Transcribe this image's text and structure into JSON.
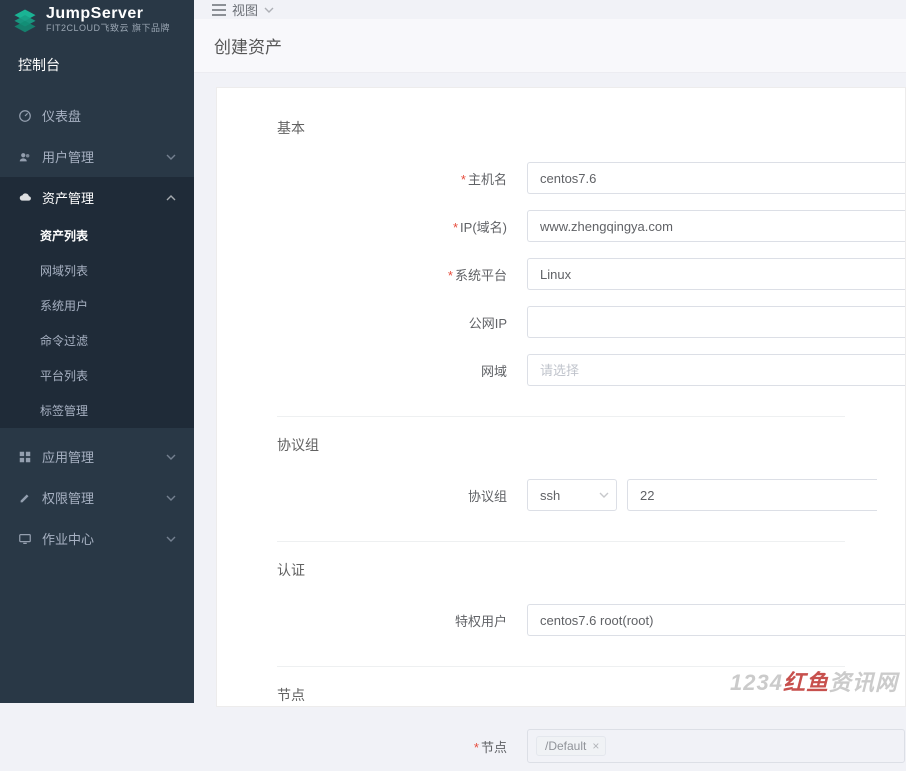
{
  "brand": {
    "title": "JumpServer",
    "subtitle": "FIT2CLOUD飞致云 旗下品牌"
  },
  "sidebar": {
    "console": "控制台",
    "items": [
      {
        "label": "仪表盘",
        "icon": "dashboard-icon"
      },
      {
        "label": "用户管理",
        "icon": "users-icon",
        "expandable": true
      },
      {
        "label": "资产管理",
        "icon": "cloud-icon",
        "expandable": true,
        "active": true,
        "children": [
          {
            "label": "资产列表",
            "active": true
          },
          {
            "label": "网域列表"
          },
          {
            "label": "系统用户"
          },
          {
            "label": "命令过滤"
          },
          {
            "label": "平台列表"
          },
          {
            "label": "标签管理"
          }
        ]
      },
      {
        "label": "应用管理",
        "icon": "grid-icon",
        "expandable": true
      },
      {
        "label": "权限管理",
        "icon": "edit-icon",
        "expandable": true
      },
      {
        "label": "作业中心",
        "icon": "display-icon",
        "expandable": true
      }
    ]
  },
  "topbar": {
    "view_label": "视图"
  },
  "page": {
    "title": "创建资产"
  },
  "sections": {
    "basic": "基本",
    "protocol": "协议组",
    "auth": "认证",
    "node": "节点"
  },
  "form": {
    "hostname": {
      "label": "主机名",
      "value": "centos7.6"
    },
    "ip": {
      "label": "IP(域名)",
      "value": "www.zhengqingya.com"
    },
    "platform": {
      "label": "系统平台",
      "value": "Linux"
    },
    "public_ip": {
      "label": "公网IP",
      "value": ""
    },
    "domain": {
      "label": "网域",
      "placeholder": "请选择",
      "value": ""
    },
    "protocol": {
      "label": "协议组",
      "proto_value": "ssh",
      "port_value": "22"
    },
    "priv_user": {
      "label": "特权用户",
      "value": "centos7.6 root(root)"
    },
    "node": {
      "label": "节点",
      "tag": "/Default"
    }
  },
  "watermark": {
    "prefix": "1234",
    "brand": "红鱼",
    "suffix": "资讯网"
  }
}
